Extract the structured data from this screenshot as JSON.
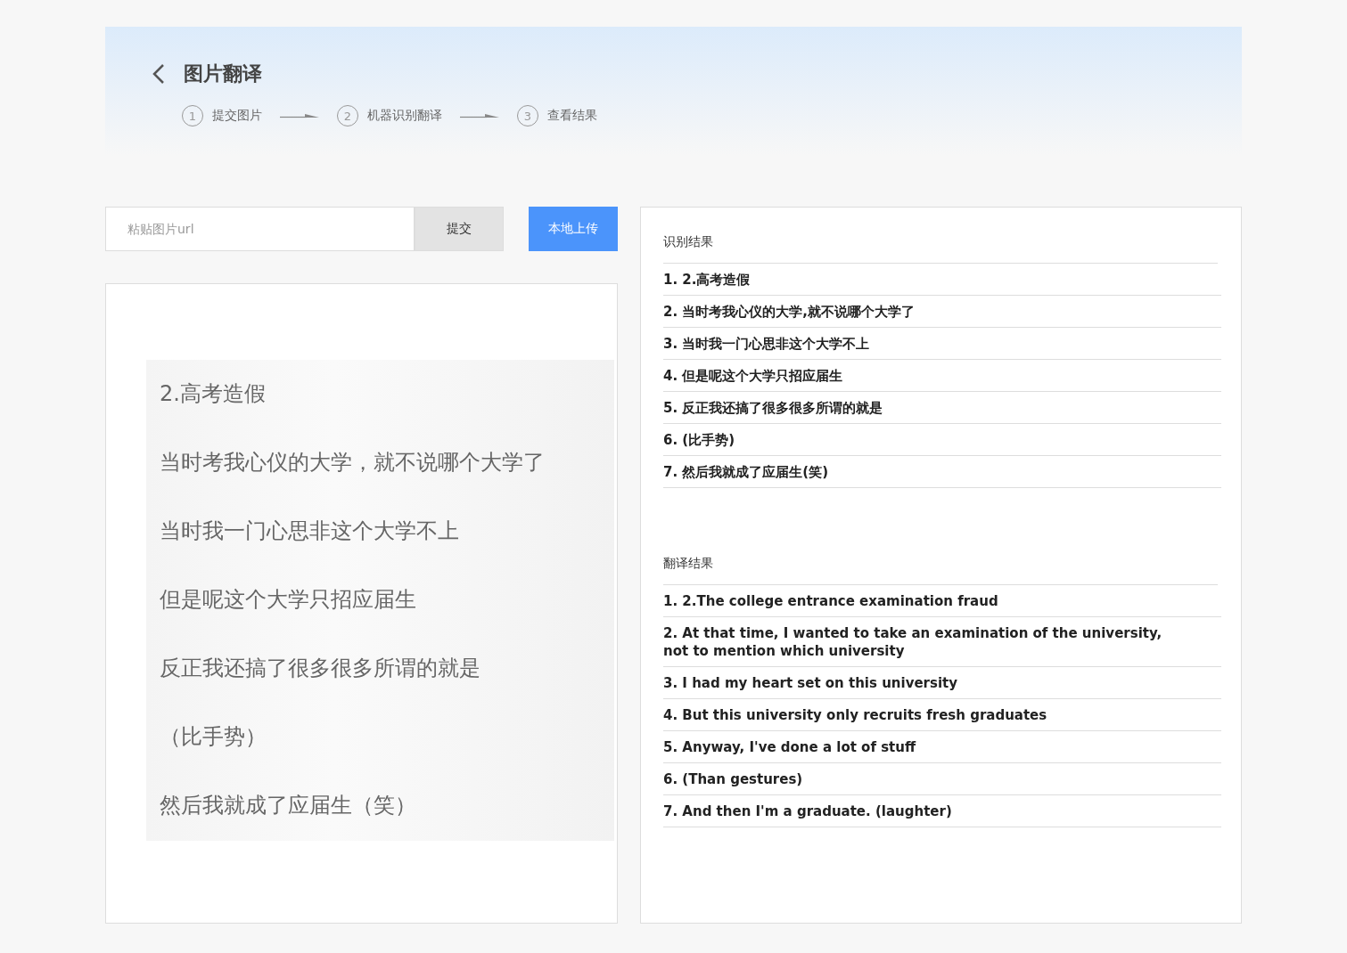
{
  "header": {
    "title": "图片翻译",
    "steps": [
      {
        "number": "1",
        "label": "提交图片"
      },
      {
        "number": "2",
        "label": "机器识别翻译"
      },
      {
        "number": "3",
        "label": "查看结果"
      }
    ]
  },
  "url_input": {
    "placeholder": "粘贴图片url"
  },
  "submit_button": "提交",
  "upload_button": "本地上传",
  "image_lines": [
    "2.高考造假",
    "当时考我心仪的大学，就不说哪个大学了",
    "当时我一门心思非这个大学不上",
    "但是呢这个大学只招应届生",
    "反正我还搞了很多很多所谓的就是",
    "（比手势）",
    "然后我就成了应届生（笑）"
  ],
  "sections": [
    {
      "title": "识别结果",
      "items": [
        "1. 2.高考造假",
        "2. 当时考我心仪的大学,就不说哪个大学了",
        "3. 当时我一门心思非这个大学不上",
        "4. 但是呢这个大学只招应届生",
        "5. 反正我还搞了很多很多所谓的就是",
        "6. (比手势)",
        "7. 然后我就成了应届生(笑)"
      ]
    },
    {
      "title": "翻译结果",
      "items": [
        "1. 2.The college entrance examination fraud",
        "2. At that time, I wanted to take an examination of the university, not to mention which university",
        "3. I had my heart set on this university",
        "4. But this university only recruits fresh graduates",
        "5. Anyway, I've done a lot of stuff",
        "6. (Than gestures)",
        "7. And then I'm a graduate. (laughter)"
      ]
    }
  ]
}
